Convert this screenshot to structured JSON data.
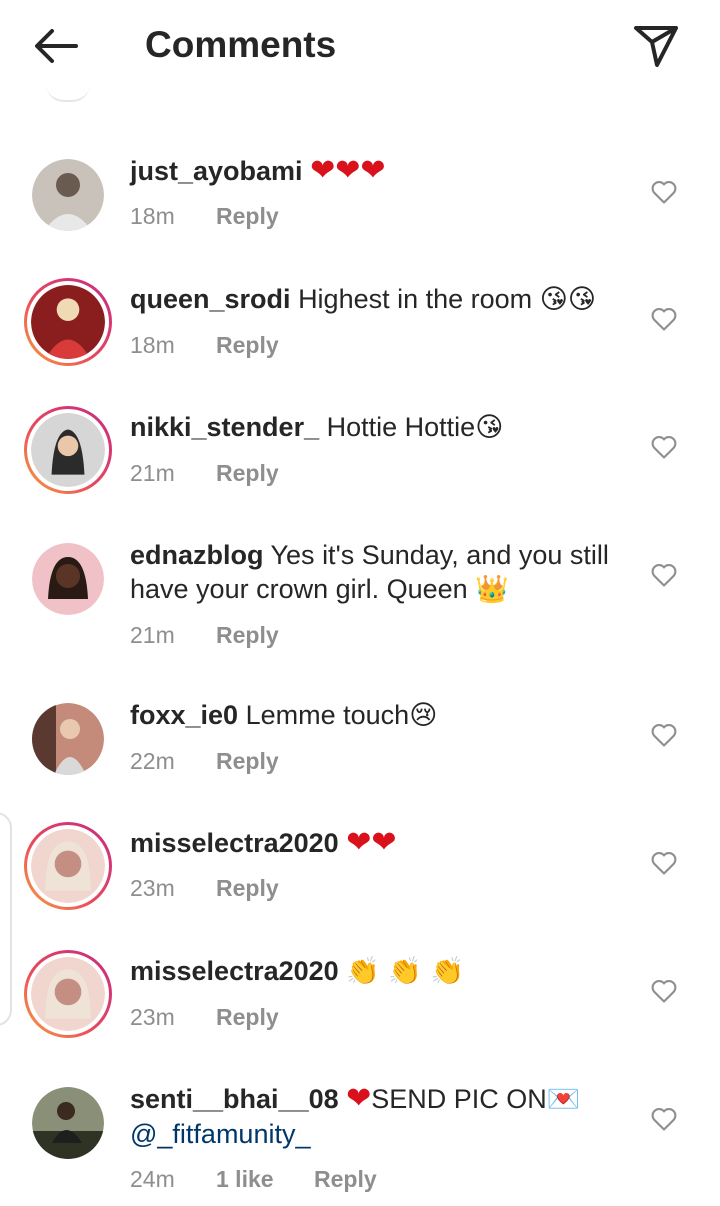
{
  "header": {
    "title": "Comments",
    "back_icon": "arrow-left-icon",
    "direct_icon": "paper-plane-icon"
  },
  "comments": [
    {
      "username": "just_ayobami",
      "text": "",
      "emoji": "❤❤❤",
      "time": "18m",
      "reply": "Reply",
      "story_ring": false,
      "avatar_colors": [
        "#c9c2bb",
        "#6a5b50"
      ]
    },
    {
      "username": "queen_srodi",
      "text": "Highest in the room",
      "emoji": "😘😘",
      "time": "18m",
      "reply": "Reply",
      "story_ring": true,
      "avatar_colors": [
        "#d93a3a",
        "#8a1e1e"
      ]
    },
    {
      "username": "nikki_stender_",
      "text": "Hottie Hottie",
      "emoji": "😘",
      "time": "21m",
      "reply": "Reply",
      "story_ring": true,
      "avatar_colors": [
        "#d6d6d6",
        "#2b2b2b"
      ]
    },
    {
      "username": "ednazblog",
      "text": "Yes it's Sunday, and you still have your crown girl. Queen",
      "emoji": "👑",
      "time": "21m",
      "reply": "Reply",
      "story_ring": false,
      "avatar_colors": [
        "#f0c2c8",
        "#5a3526"
      ]
    },
    {
      "username": "foxx_ie0",
      "text": "Lemme touch",
      "emoji": "😢",
      "time": "22m",
      "reply": "Reply",
      "story_ring": false,
      "avatar_colors": [
        "#c48a7a",
        "#5a3a30"
      ]
    },
    {
      "username": "misselectra2020",
      "text": "",
      "emoji": "❤❤",
      "time": "23m",
      "reply": "Reply",
      "story_ring": true,
      "avatar_colors": [
        "#f1d6cf",
        "#c58e82"
      ]
    },
    {
      "username": "misselectra2020",
      "text": "",
      "emoji": "👏 👏 👏",
      "time": "23m",
      "reply": "Reply",
      "story_ring": true,
      "avatar_colors": [
        "#f1d6cf",
        "#c58e82"
      ]
    },
    {
      "username": "senti__bhai__08",
      "text": "SEND PIC ON",
      "emoji": "💌",
      "mention": "@_fitfamunity_",
      "time": "24m",
      "likes": "1 like",
      "reply": "Reply",
      "story_ring": false,
      "avatar_colors": [
        "#8a8f78",
        "#2f3324"
      ]
    }
  ],
  "colors": {
    "text": "#262626",
    "secondary": "#8e8e8e",
    "heart": "#d9111c",
    "mention": "#00376b"
  },
  "icons": {
    "like": "heart-outline-icon"
  }
}
